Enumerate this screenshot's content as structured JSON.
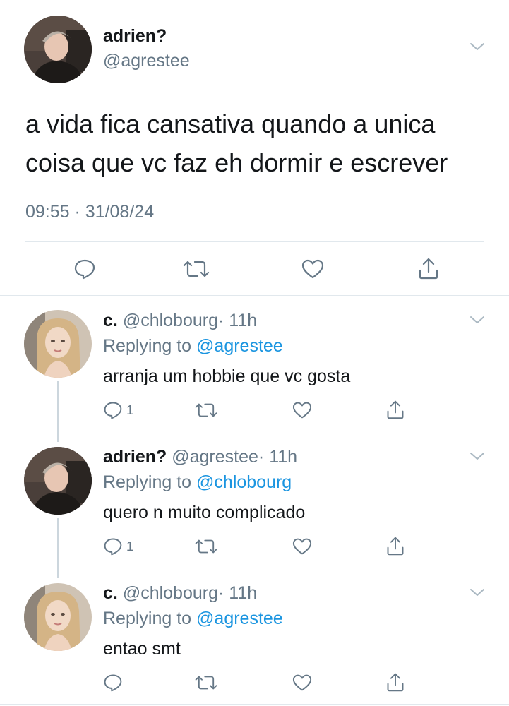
{
  "main_tweet": {
    "name": "adrien?",
    "handle": "@agrestee",
    "text": "a vida fica cansativa quando a unica coisa que vc faz eh dormir e escrever",
    "timestamp": "09:55 · 31/08/24"
  },
  "replies": [
    {
      "name": "c.",
      "handle": "@chlobourg",
      "time": "· 11h",
      "replying_prefix": "Replying to",
      "replying_to": "@agrestee",
      "text": "arranja um hobbie que vc gosta",
      "reply_count": "1"
    },
    {
      "name": "adrien?",
      "handle": "@agrestee",
      "time": "· 11h",
      "replying_prefix": "Replying to",
      "replying_to": "@chlobourg",
      "text": "quero n muito complicado",
      "reply_count": "1"
    },
    {
      "name": "c.",
      "handle": "@chlobourg",
      "time": "· 11h",
      "replying_prefix": "Replying to",
      "replying_to": "@agrestee",
      "text": "entao smt",
      "reply_count": ""
    }
  ],
  "icons": [
    "reply-icon",
    "retweet-icon",
    "like-icon",
    "share-icon",
    "chevron-down-icon"
  ],
  "colors": {
    "link": "#1b95e0",
    "secondary_text": "#657786",
    "primary_text": "#14171a",
    "divider": "#e1e8ed"
  }
}
